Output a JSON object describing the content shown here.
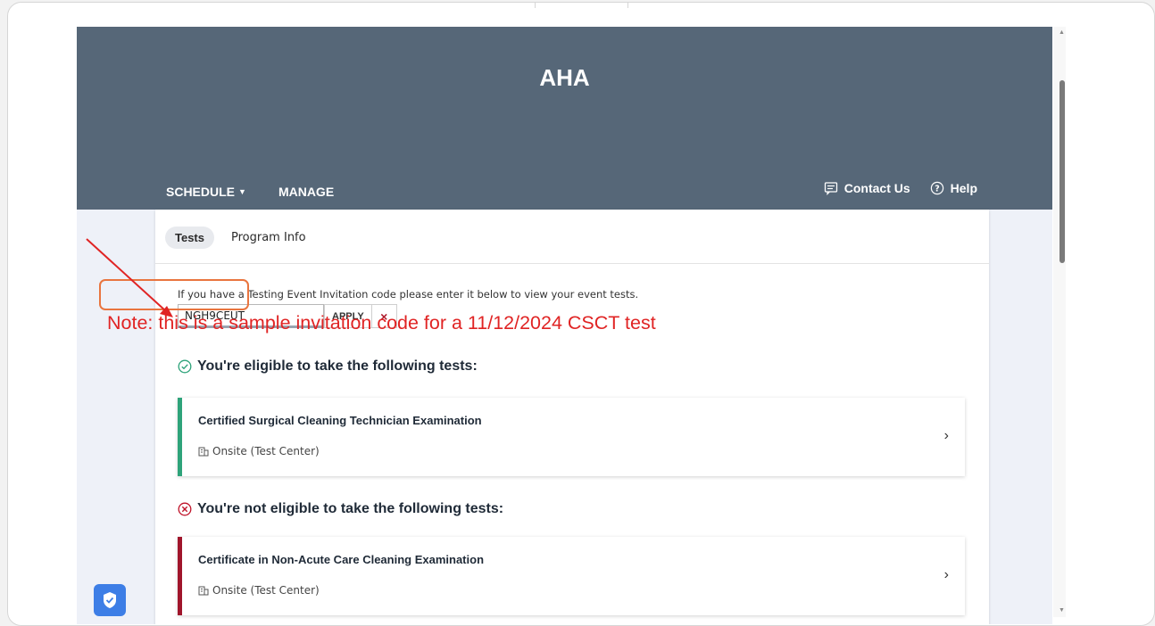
{
  "header": {
    "brand": "AHA",
    "nav": {
      "schedule_label": "SCHEDULE",
      "manage_label": "MANAGE"
    },
    "links": {
      "contact_label": "Contact Us",
      "help_label": "Help"
    }
  },
  "tabs": [
    {
      "label": "Tests",
      "active": true
    },
    {
      "label": "Program Info",
      "active": false
    }
  ],
  "invitation": {
    "prompt": "If you have a Testing Event Invitation code please enter it below to view your event tests.",
    "code_value": "NGH9CEUT",
    "apply_label": "APPLY",
    "clear_label": "×"
  },
  "annotation": {
    "note": "Note: this is a sample invitation code for a 11/12/2024 CSCT test",
    "note_color": "#e02424",
    "highlight_color": "#e9753f"
  },
  "eligible": {
    "title": "You're eligible to take the following tests:",
    "tests": [
      {
        "name": "Certified Surgical Cleaning Technician Examination",
        "mode": "Onsite (Test Center)",
        "accent": "#2ea37a"
      }
    ]
  },
  "not_eligible": {
    "title": "You're not eligible to take the following tests:",
    "tests": [
      {
        "name": "Certificate in Non-Acute Care Cleaning Examination",
        "mode": "Onsite (Test Center)",
        "accent": "#a0152b"
      }
    ]
  },
  "colors": {
    "header_bg": "#566778",
    "page_bg": "#eef1f8",
    "eligible_icon": "#2ea37a",
    "not_eligible_icon": "#c0152b"
  }
}
